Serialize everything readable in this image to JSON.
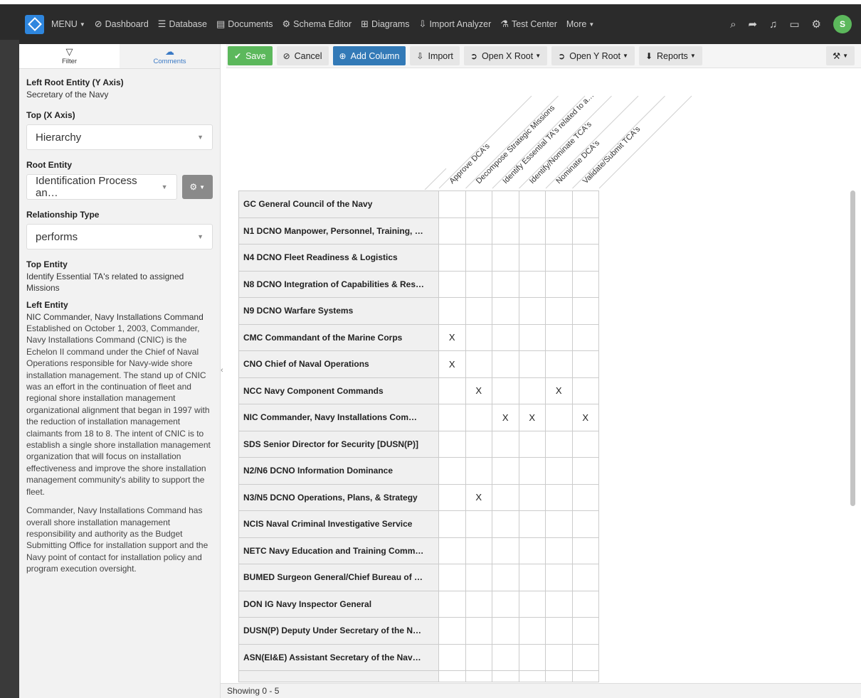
{
  "navbar": {
    "menu_label": "MENU",
    "items": [
      {
        "label": "Dashboard",
        "icon": "dashboard-icon",
        "glyph": "⊘"
      },
      {
        "label": "Database",
        "icon": "database-icon",
        "glyph": "☰"
      },
      {
        "label": "Documents",
        "icon": "document-icon",
        "glyph": "▤"
      },
      {
        "label": "Schema Editor",
        "icon": "schema-icon",
        "glyph": "⚙"
      },
      {
        "label": "Diagrams",
        "icon": "diagram-icon",
        "glyph": "⊞"
      },
      {
        "label": "Import Analyzer",
        "icon": "import-analyzer-icon",
        "glyph": "⇩"
      },
      {
        "label": "Test Center",
        "icon": "flask-icon",
        "glyph": "⚗"
      },
      {
        "label": "More",
        "icon": "",
        "glyph": ""
      }
    ],
    "avatar_initial": "S"
  },
  "sidebar": {
    "tab_filter": "Filter",
    "tab_comments": "Comments",
    "left_root_label": "Left Root Entity (Y Axis)",
    "left_root_value": "Secretary of the Navy",
    "top_label": "Top (X Axis)",
    "top_value": "Hierarchy",
    "root_entity_label": "Root Entity",
    "root_entity_value": "Identification Process an…",
    "relationship_label": "Relationship Type",
    "relationship_value": "performs",
    "top_entity_label": "Top Entity",
    "top_entity_value": "Identify Essential TA's related to assigned Missions",
    "left_entity_label": "Left Entity",
    "left_entity_value": "NIC Commander, Navy Installations Command",
    "description_1": "Established on October 1, 2003, Commander, Navy Installations Command (CNIC) is the Echelon II command under the Chief of Naval Operations responsible for Navy-wide shore installation management. The stand up of CNIC was an effort in the continuation of fleet and regional shore installation management organizational alignment that began in 1997 with the reduction of installation management claimants from 18 to 8. The intent of CNIC is to establish a single shore installation management organization that will focus on installation effectiveness and improve the shore installation management community's ability to support the fleet.",
    "description_2": "Commander, Navy Installations Command has overall shore installation management responsibility and authority as the Budget Submitting Office for installation support and the Navy point of contact for installation policy and program execution oversight."
  },
  "toolbar": {
    "save": "Save",
    "cancel": "Cancel",
    "add_column": "Add Column",
    "import": "Import",
    "open_x_root": "Open X Root",
    "open_y_root": "Open Y Root",
    "reports": "Reports"
  },
  "matrix": {
    "columns": [
      "Approve DCA's",
      "Decompose Strategic Missions",
      "Identify Essential TA's related to a…",
      "Identify/Nominate TCA's",
      "Nominate DCA's",
      "Validate/Submit TCA's"
    ],
    "rows": [
      {
        "label": "GC General Council of the Navy",
        "cells": [
          "",
          "",
          "",
          "",
          "",
          ""
        ]
      },
      {
        "label": "N1 DCNO Manpower, Personnel, Training, …",
        "cells": [
          "",
          "",
          "",
          "",
          "",
          ""
        ]
      },
      {
        "label": "N4 DCNO Fleet Readiness & Logistics",
        "cells": [
          "",
          "",
          "",
          "",
          "",
          ""
        ]
      },
      {
        "label": "N8 DCNO Integration of Capabilities & Res…",
        "cells": [
          "",
          "",
          "",
          "",
          "",
          ""
        ]
      },
      {
        "label": "N9 DCNO Warfare Systems",
        "cells": [
          "",
          "",
          "",
          "",
          "",
          ""
        ]
      },
      {
        "label": "CMC Commandant of the Marine Corps",
        "cells": [
          "X",
          "",
          "",
          "",
          "",
          ""
        ]
      },
      {
        "label": "CNO Chief of Naval Operations",
        "cells": [
          "X",
          "",
          "",
          "",
          "",
          ""
        ]
      },
      {
        "label": "NCC Navy Component Commands",
        "cells": [
          "",
          "X",
          "",
          "",
          "X",
          ""
        ]
      },
      {
        "label": "NIC Commander, Navy Installations Com…",
        "cells": [
          "",
          "",
          "X",
          "X",
          "",
          "X"
        ]
      },
      {
        "label": "SDS Senior Director for Security [DUSN(P)]",
        "cells": [
          "",
          "",
          "",
          "",
          "",
          ""
        ]
      },
      {
        "label": "N2/N6 DCNO Information Dominance",
        "cells": [
          "",
          "",
          "",
          "",
          "",
          ""
        ]
      },
      {
        "label": "N3/N5 DCNO Operations, Plans, & Strategy",
        "cells": [
          "",
          "X",
          "",
          "",
          "",
          ""
        ]
      },
      {
        "label": "NCIS Naval Criminal Investigative Service",
        "cells": [
          "",
          "",
          "",
          "",
          "",
          ""
        ]
      },
      {
        "label": "NETC Navy Education and Training Comm…",
        "cells": [
          "",
          "",
          "",
          "",
          "",
          ""
        ]
      },
      {
        "label": "BUMED Surgeon General/Chief Bureau of …",
        "cells": [
          "",
          "",
          "",
          "",
          "",
          ""
        ]
      },
      {
        "label": "DON IG Navy Inspector General",
        "cells": [
          "",
          "",
          "",
          "",
          "",
          ""
        ]
      },
      {
        "label": "DUSN(P) Deputy Under Secretary of the N…",
        "cells": [
          "",
          "",
          "",
          "",
          "",
          ""
        ]
      },
      {
        "label": "ASN(EI&E) Assistant Secretary of the Nav…",
        "cells": [
          "",
          "",
          "",
          "",
          "",
          ""
        ]
      }
    ]
  },
  "footer": {
    "status": "Showing 0 - 5"
  }
}
